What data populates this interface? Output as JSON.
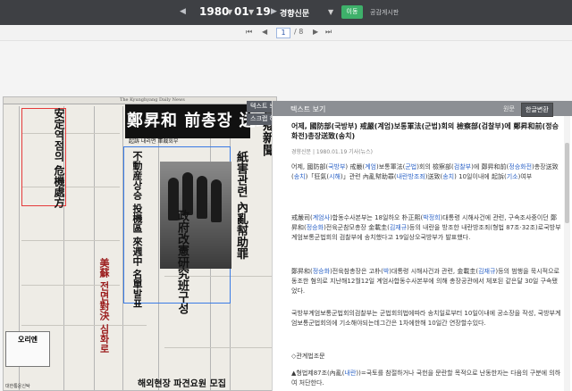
{
  "toolbar": {
    "year": "1980",
    "month": "01",
    "day": "19",
    "newspaper": "경향신문",
    "go_label": "이동",
    "share_label": "공감게시판",
    "current_page": "1",
    "total_pages": "/ 8"
  },
  "newspaper_image": {
    "masthead": "The Kyunghyang Daily News",
    "headline": "鄭昇和 前총장 送致",
    "sub_headline": "起訴 내리면 軍裁회부",
    "side_heading_1": "安定역점의 危機處方",
    "side_heading_2": "政府改憲研究班구성",
    "side_heading_3": "不動産상승 投機區 來週中 名單발표",
    "side_heading_4": "美蘇 전면對決 심화로",
    "side_heading_5": "紙害관련 內亂幇助罪",
    "side_heading_6": "京鄕新聞",
    "banner_bottom": "해외현장 파견요원 모집",
    "banner_left": "대한통운신탁",
    "ad_label": "오리엔"
  },
  "side_tabs": {
    "text_view": "텍스트 보기",
    "scrap": "스크랩 하기"
  },
  "panel": {
    "title": "텍스트 보기",
    "lang_original": "원문",
    "lang_convert": "한글변환"
  },
  "article": {
    "title": "어제, 國防部(국방부) 戒嚴(계엄)보통軍法(군법)회의 檢察部(검찰부)에 鄭昇和前(정승화전)총장送致(송치)",
    "meta": "경향신문 | 1980.01.19 기사(뉴스)",
    "p1": [
      {
        "t": "어제, 國防部(",
        "c": "n"
      },
      {
        "t": "국방부",
        "c": "b"
      },
      {
        "t": ") 戒嚴(",
        "c": "n"
      },
      {
        "t": "계엄",
        "c": "b"
      },
      {
        "t": ")보통軍法(",
        "c": "n"
      },
      {
        "t": "군법",
        "c": "b"
      },
      {
        "t": ")회의 檢察部(",
        "c": "n"
      },
      {
        "t": "검찰부",
        "c": "b"
      },
      {
        "t": ")에 鄭昇和前(",
        "c": "n"
      },
      {
        "t": "정승화전",
        "c": "b"
      },
      {
        "t": ")총장送致(",
        "c": "n"
      },
      {
        "t": "송치",
        "c": "b"
      },
      {
        "t": ")",
        "c": "n"
      },
      {
        "t": "「狂氣(",
        "c": "n"
      },
      {
        "t": "시해",
        "c": "b"
      },
      {
        "t": ")」관련 內亂幇助罪(",
        "c": "n"
      },
      {
        "t": "내란방조죄",
        "c": "b"
      },
      {
        "t": ")",
        "c": "n"
      },
      {
        "t": "送致(",
        "c": "n"
      },
      {
        "t": "송치",
        "c": "b"
      },
      {
        "t": ") 10일이내에 起訴(",
        "c": "n"
      },
      {
        "t": "기소",
        "c": "b"
      },
      {
        "t": ")여부",
        "c": "n"
      }
    ],
    "p2": [
      {
        "t": "戒嚴司(",
        "c": "n"
      },
      {
        "t": "계엄사",
        "c": "b"
      },
      {
        "t": ")합동수사본부는 18일하오 朴正熙(",
        "c": "n"
      },
      {
        "t": "박정희",
        "c": "b"
      },
      {
        "t": ")대통령 시해사건에 관련, 구속조사중이던 鄭昇和(",
        "c": "n"
      },
      {
        "t": "정승화",
        "c": "b"
      },
      {
        "t": ")전육군참모총장 金載圭(",
        "c": "n"
      },
      {
        "t": "김재규",
        "c": "b"
      },
      {
        "t": ")등의 내란을 방조한 내란방조죄(형법 87조·32조)로국방부계엄보통군법회의 검찰부에 송치했다고 19일상오국방부가 발표했다.",
        "c": "n"
      }
    ],
    "p3": [
      {
        "t": "鄭昇和(",
        "c": "n"
      },
      {
        "t": "정승화",
        "c": "b"
      },
      {
        "t": ")전육참총장은 고朴(",
        "c": "n"
      },
      {
        "t": "박",
        "c": "b"
      },
      {
        "t": ")대통령 시해사건과 관련, 金載圭(",
        "c": "n"
      },
      {
        "t": "김재규",
        "c": "b"
      },
      {
        "t": ")등의 범행을 묵시적으로동조한 혐의로 지난해12월12일 계엄사합동수사본부에 의해 총장공관에서 체포된 같은달 30일 구속됐었다.",
        "c": "n"
      }
    ],
    "p4": [
      {
        "t": "국방부계엄보통군법회의검찰부는 군법회의법에따라 송치일로부터 10일이내에 공소장을 작성, 국방부계엄보통군법회의에 기소해야되는데그간은 1차에한해 10일간 연장할수있다.",
        "c": "n"
      }
    ],
    "p5": [
      {
        "t": "◇관계법조문",
        "c": "n"
      }
    ],
    "p6": [
      {
        "t": "▲형법제87조(內亂(",
        "c": "n"
      },
      {
        "t": "내란",
        "c": "b"
      },
      {
        "t": "))=국토를 참절하거나 국헌을 문란할 목적으로 난동한자는 다음의 구분에 의하여 처단한다.",
        "c": "n"
      }
    ]
  }
}
